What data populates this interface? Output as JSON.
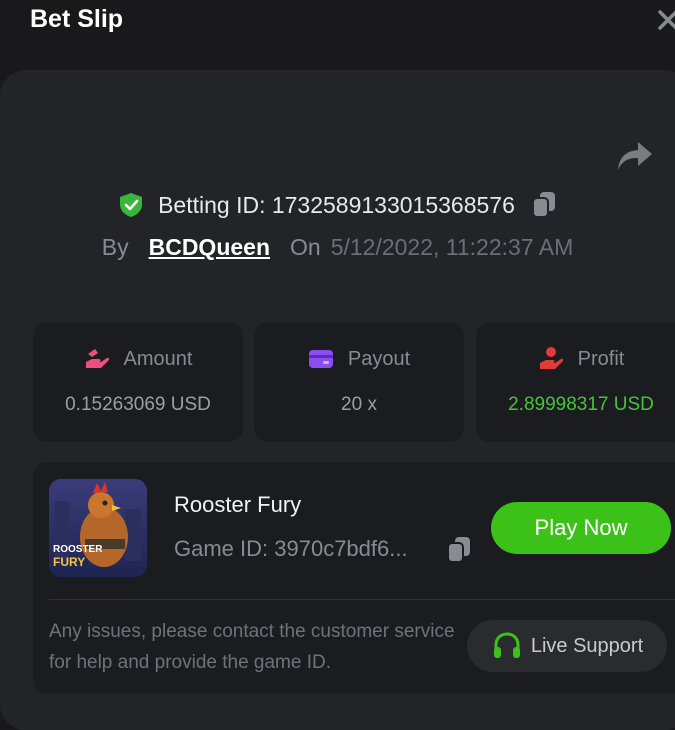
{
  "header": {
    "title": "Bet Slip"
  },
  "bet": {
    "id_label": "Betting ID: 1732589133015368576",
    "by_label": "By",
    "user": "BCDQueen",
    "on_label": "On",
    "date": "5/12/2022, 11:22:37 AM"
  },
  "stats": {
    "amount": {
      "label": "Amount",
      "value": "0.15263069 USD"
    },
    "payout": {
      "label": "Payout",
      "value": "20 x"
    },
    "profit": {
      "label": "Profit",
      "value": "2.89998317 USD"
    }
  },
  "game": {
    "name": "Rooster Fury",
    "id": "Game ID: 3970c7bdf6...",
    "thumb_line1": "ROOSTER",
    "thumb_line2": "FURY",
    "play_label": "Play Now"
  },
  "support": {
    "help_text": "Any issues, please contact the customer service for help and provide the game ID.",
    "button_label": "Live Support"
  },
  "colors": {
    "background": "#19191c",
    "panel": "#232428",
    "card": "#1b1c1f",
    "accent_green": "#3bc117",
    "profit_green": "#47c23a"
  },
  "icons": [
    "close-icon",
    "share-icon",
    "shield-check-icon",
    "copy-icon",
    "amount-icon",
    "payout-icon",
    "profit-icon",
    "headset-icon"
  ]
}
